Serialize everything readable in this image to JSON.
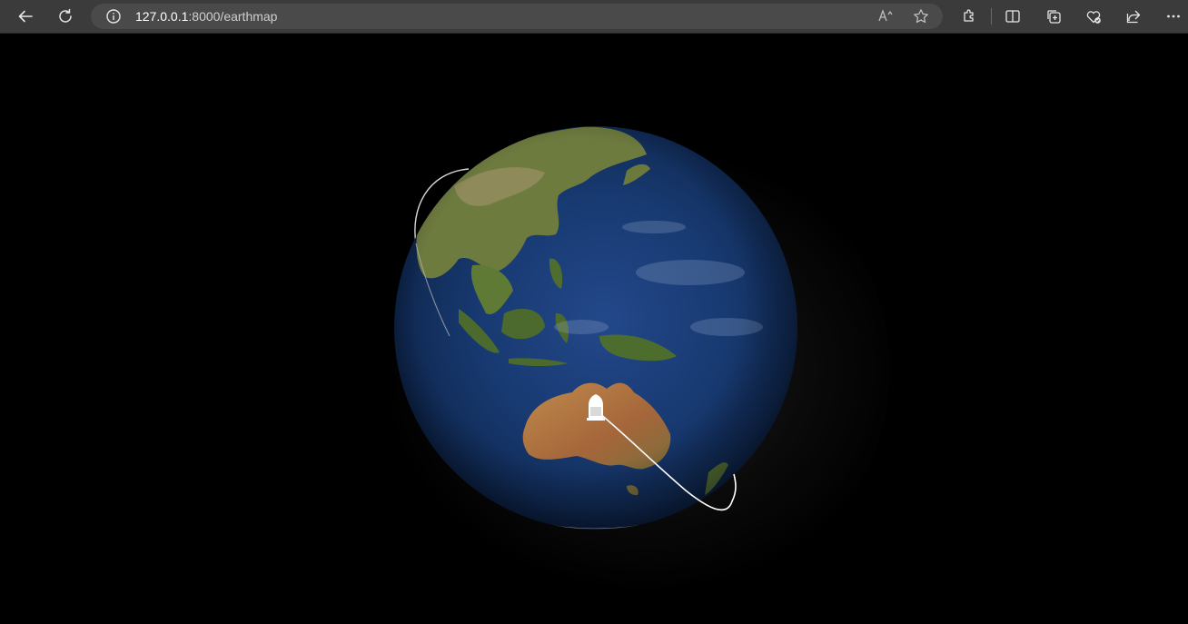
{
  "browser": {
    "url_host": "127.0.0.1",
    "url_path": ":8000/earthmap",
    "icons": [
      "back-icon",
      "refresh-icon",
      "info-icon",
      "read-aloud-icon",
      "favorite-star-icon",
      "extensions-icon",
      "split-screen-icon",
      "collections-icon",
      "browser-essentials-icon",
      "share-icon",
      "more-icon"
    ]
  },
  "scene": {
    "description_hidden": "",
    "background": "#000000",
    "ocean_color": "#1b3f7a",
    "land_color": "#6f7d3e",
    "desert_color": "#b5783f",
    "orbit_color": "#ffffff"
  }
}
